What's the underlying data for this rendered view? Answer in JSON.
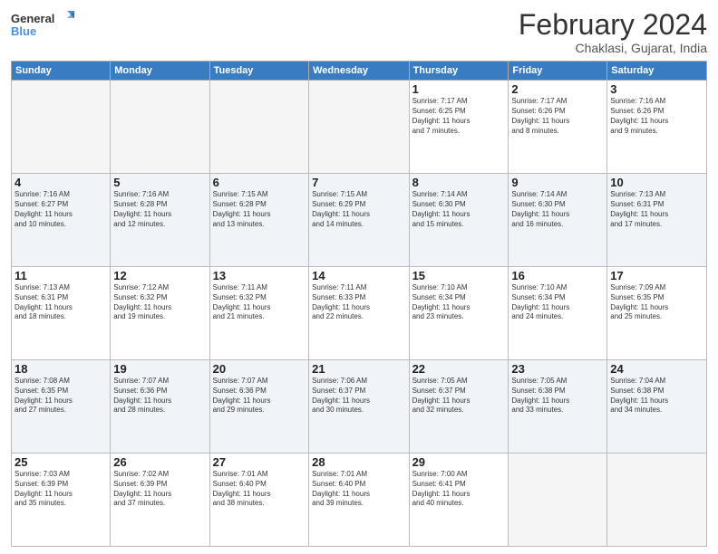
{
  "header": {
    "logo_line1": "General",
    "logo_line2": "Blue",
    "month": "February 2024",
    "location": "Chaklasi, Gujarat, India"
  },
  "weekdays": [
    "Sunday",
    "Monday",
    "Tuesday",
    "Wednesday",
    "Thursday",
    "Friday",
    "Saturday"
  ],
  "weeks": [
    [
      {
        "day": "",
        "info": ""
      },
      {
        "day": "",
        "info": ""
      },
      {
        "day": "",
        "info": ""
      },
      {
        "day": "",
        "info": ""
      },
      {
        "day": "1",
        "info": "Sunrise: 7:17 AM\nSunset: 6:25 PM\nDaylight: 11 hours\nand 7 minutes."
      },
      {
        "day": "2",
        "info": "Sunrise: 7:17 AM\nSunset: 6:26 PM\nDaylight: 11 hours\nand 8 minutes."
      },
      {
        "day": "3",
        "info": "Sunrise: 7:16 AM\nSunset: 6:26 PM\nDaylight: 11 hours\nand 9 minutes."
      }
    ],
    [
      {
        "day": "4",
        "info": "Sunrise: 7:16 AM\nSunset: 6:27 PM\nDaylight: 11 hours\nand 10 minutes."
      },
      {
        "day": "5",
        "info": "Sunrise: 7:16 AM\nSunset: 6:28 PM\nDaylight: 11 hours\nand 12 minutes."
      },
      {
        "day": "6",
        "info": "Sunrise: 7:15 AM\nSunset: 6:28 PM\nDaylight: 11 hours\nand 13 minutes."
      },
      {
        "day": "7",
        "info": "Sunrise: 7:15 AM\nSunset: 6:29 PM\nDaylight: 11 hours\nand 14 minutes."
      },
      {
        "day": "8",
        "info": "Sunrise: 7:14 AM\nSunset: 6:30 PM\nDaylight: 11 hours\nand 15 minutes."
      },
      {
        "day": "9",
        "info": "Sunrise: 7:14 AM\nSunset: 6:30 PM\nDaylight: 11 hours\nand 16 minutes."
      },
      {
        "day": "10",
        "info": "Sunrise: 7:13 AM\nSunset: 6:31 PM\nDaylight: 11 hours\nand 17 minutes."
      }
    ],
    [
      {
        "day": "11",
        "info": "Sunrise: 7:13 AM\nSunset: 6:31 PM\nDaylight: 11 hours\nand 18 minutes."
      },
      {
        "day": "12",
        "info": "Sunrise: 7:12 AM\nSunset: 6:32 PM\nDaylight: 11 hours\nand 19 minutes."
      },
      {
        "day": "13",
        "info": "Sunrise: 7:11 AM\nSunset: 6:32 PM\nDaylight: 11 hours\nand 21 minutes."
      },
      {
        "day": "14",
        "info": "Sunrise: 7:11 AM\nSunset: 6:33 PM\nDaylight: 11 hours\nand 22 minutes."
      },
      {
        "day": "15",
        "info": "Sunrise: 7:10 AM\nSunset: 6:34 PM\nDaylight: 11 hours\nand 23 minutes."
      },
      {
        "day": "16",
        "info": "Sunrise: 7:10 AM\nSunset: 6:34 PM\nDaylight: 11 hours\nand 24 minutes."
      },
      {
        "day": "17",
        "info": "Sunrise: 7:09 AM\nSunset: 6:35 PM\nDaylight: 11 hours\nand 25 minutes."
      }
    ],
    [
      {
        "day": "18",
        "info": "Sunrise: 7:08 AM\nSunset: 6:35 PM\nDaylight: 11 hours\nand 27 minutes."
      },
      {
        "day": "19",
        "info": "Sunrise: 7:07 AM\nSunset: 6:36 PM\nDaylight: 11 hours\nand 28 minutes."
      },
      {
        "day": "20",
        "info": "Sunrise: 7:07 AM\nSunset: 6:36 PM\nDaylight: 11 hours\nand 29 minutes."
      },
      {
        "day": "21",
        "info": "Sunrise: 7:06 AM\nSunset: 6:37 PM\nDaylight: 11 hours\nand 30 minutes."
      },
      {
        "day": "22",
        "info": "Sunrise: 7:05 AM\nSunset: 6:37 PM\nDaylight: 11 hours\nand 32 minutes."
      },
      {
        "day": "23",
        "info": "Sunrise: 7:05 AM\nSunset: 6:38 PM\nDaylight: 11 hours\nand 33 minutes."
      },
      {
        "day": "24",
        "info": "Sunrise: 7:04 AM\nSunset: 6:38 PM\nDaylight: 11 hours\nand 34 minutes."
      }
    ],
    [
      {
        "day": "25",
        "info": "Sunrise: 7:03 AM\nSunset: 6:39 PM\nDaylight: 11 hours\nand 35 minutes."
      },
      {
        "day": "26",
        "info": "Sunrise: 7:02 AM\nSunset: 6:39 PM\nDaylight: 11 hours\nand 37 minutes."
      },
      {
        "day": "27",
        "info": "Sunrise: 7:01 AM\nSunset: 6:40 PM\nDaylight: 11 hours\nand 38 minutes."
      },
      {
        "day": "28",
        "info": "Sunrise: 7:01 AM\nSunset: 6:40 PM\nDaylight: 11 hours\nand 39 minutes."
      },
      {
        "day": "29",
        "info": "Sunrise: 7:00 AM\nSunset: 6:41 PM\nDaylight: 11 hours\nand 40 minutes."
      },
      {
        "day": "",
        "info": ""
      },
      {
        "day": "",
        "info": ""
      }
    ]
  ]
}
